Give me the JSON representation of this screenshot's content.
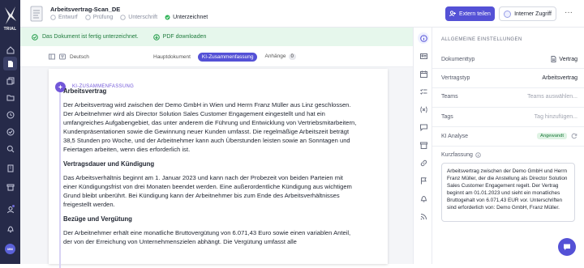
{
  "rail": {
    "trial": "TRIAL",
    "avatar": "MM",
    "items": [
      "home-icon",
      "document-icon",
      "documents-icon",
      "folder-icon",
      "clock-icon",
      "check-circle-icon",
      "search-icon",
      "building-icon",
      "archive-icon",
      "user-icon",
      "bell-icon"
    ]
  },
  "header": {
    "title": "Arbeitsvertrag-Scan_DE",
    "steps": [
      {
        "label": "Entwurf",
        "done": false
      },
      {
        "label": "Prüfung",
        "done": false
      },
      {
        "label": "Unterschrift",
        "done": false
      },
      {
        "label": "Unterzeichnet",
        "done": true
      }
    ],
    "share_label": "Extern teilen",
    "internal_label": "Interner Zugriff",
    "more": "···"
  },
  "success_bar": {
    "message": "Das Dokument ist fertig unterzeichnet.",
    "pdf_label": "PDF downloaden"
  },
  "toolbar": {
    "language": "Deutsch",
    "tabs": [
      {
        "label": "Hauptdokument"
      },
      {
        "label": "KI-Zusammenfassung"
      },
      {
        "label": "Anhänge",
        "badge": "0"
      }
    ]
  },
  "summary": {
    "label": "KI-ZUSAMMENFASSUNG",
    "sections": [
      {
        "heading": "Arbeitsvertrag",
        "body": "Der Arbeitsvertrag wird zwischen der Demo GmbH in Wien und Herrn Franz Müller aus Linz geschlossen. Der Arbeitnehmer wird als Director Solution Sales Customer Engagement eingestellt und hat ein umfangreiches Aufgabengebiet, das unter anderem die Führung und Entwicklung von Vertriebsmitarbeitern, Kundenpräsentationen sowie die Gewinnung neuer Kunden umfasst. Die regelmäßige Arbeitszeit beträgt 38,5 Stunden pro Woche, und der Arbeitnehmer kann auch Überstunden leisten sowie an Sonntagen und Feiertagen arbeiten, wenn dies erforderlich ist."
      },
      {
        "heading": "Vertragsdauer und Kündigung",
        "body": "Das Arbeitsverhältnis beginnt am 1. Januar 2023 und kann nach der Probezeit von beiden Parteien mit einer Kündigungsfrist von drei Monaten beendet werden. Eine außerordentliche Kündigung aus wichtigem Grund bleibt unberührt. Bei Kündigung kann der Arbeitnehmer bis zum Ende des Arbeitsverhältnisses freigestellt werden."
      },
      {
        "heading": "Bezüge und Vergütung",
        "body": "Der Arbeitnehmer erhält eine monatliche Bruttovergütung von 6.071,43 Euro sowie einen variablen Anteil, der von der Erreichung von Unternehmenszielen abhängt. Die Vergütung umfasst alle"
      }
    ]
  },
  "props": {
    "section_title": "ALLGEMEINE EINSTELLUNGEN",
    "rows": [
      {
        "key": "Dokumenttyp",
        "value": "Vertrag"
      },
      {
        "key": "Vertragstyp",
        "value": "Arbeitsvertrag"
      },
      {
        "key": "Teams",
        "value": "Teams auswählen..."
      },
      {
        "key": "Tags",
        "value": "Tag hinzufügen..."
      },
      {
        "key": "KI Analyse",
        "value": "Angewandt"
      }
    ],
    "kurz_label": "Kurzfassung",
    "kurz_text": "Arbeitsvertrag zwischen der Demo GmbH und Herrn Franz Müller, der die Anstellung als Director Solution Sales Customer Engagement regelt. Der Vertrag beginnt am 01.01.2023 und sieht ein monatliches Bruttogehalt von 6.071,43 EUR vor. Unterschriften sind erforderlich von: Demo GmbH, Franz Müller."
  },
  "colors": {
    "rail": "#262a49",
    "accent": "#5451d6",
    "success_bg": "#e6f7ec",
    "success_text": "#1e7a3c"
  }
}
